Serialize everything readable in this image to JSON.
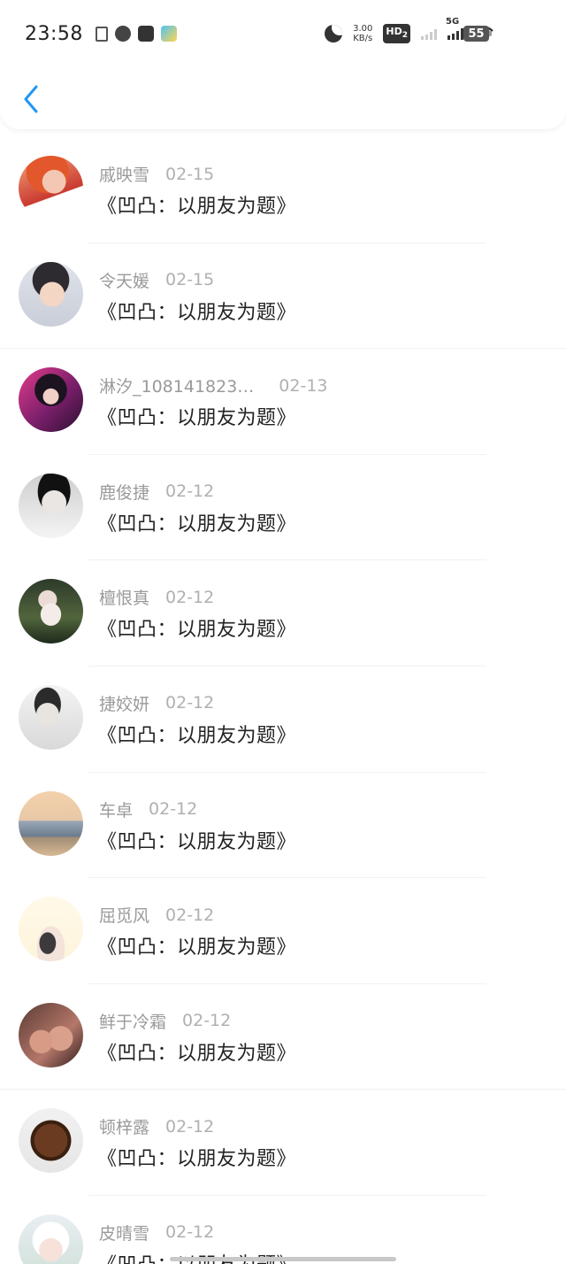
{
  "status_bar": {
    "time": "23:58",
    "net_speed_value": "3.00",
    "net_speed_unit": "KB/s",
    "hd_label": "HD",
    "hd_sub": "2",
    "network_type": "5G",
    "battery": "55"
  },
  "header": {
    "back_icon": "chevron-left-icon",
    "accent_color": "#2196f3"
  },
  "items": [
    {
      "name": "戚映雪",
      "date": "02-15",
      "title": "《凹凸：以朋友为题》"
    },
    {
      "name": "令天媛",
      "date": "02-15",
      "title": "《凹凸：以朋友为题》"
    },
    {
      "name": "淋汐_108141823…",
      "date": "02-13",
      "title": "《凹凸：以朋友为题》"
    },
    {
      "name": "鹿俊捷",
      "date": "02-12",
      "title": "《凹凸：以朋友为题》"
    },
    {
      "name": "檀恨真",
      "date": "02-12",
      "title": "《凹凸：以朋友为题》"
    },
    {
      "name": "捷姣妍",
      "date": "02-12",
      "title": "《凹凸：以朋友为题》"
    },
    {
      "name": "车卓",
      "date": "02-12",
      "title": "《凹凸：以朋友为题》"
    },
    {
      "name": "屈觅风",
      "date": "02-12",
      "title": "《凹凸：以朋友为题》"
    },
    {
      "name": "鲜于冷霜",
      "date": "02-12",
      "title": "《凹凸：以朋友为题》"
    },
    {
      "name": "顿梓露",
      "date": "02-12",
      "title": "《凹凸：以朋友为题》"
    },
    {
      "name": "皮晴雪",
      "date": "02-12",
      "title": "《凹凸：以朋友为题》"
    }
  ]
}
